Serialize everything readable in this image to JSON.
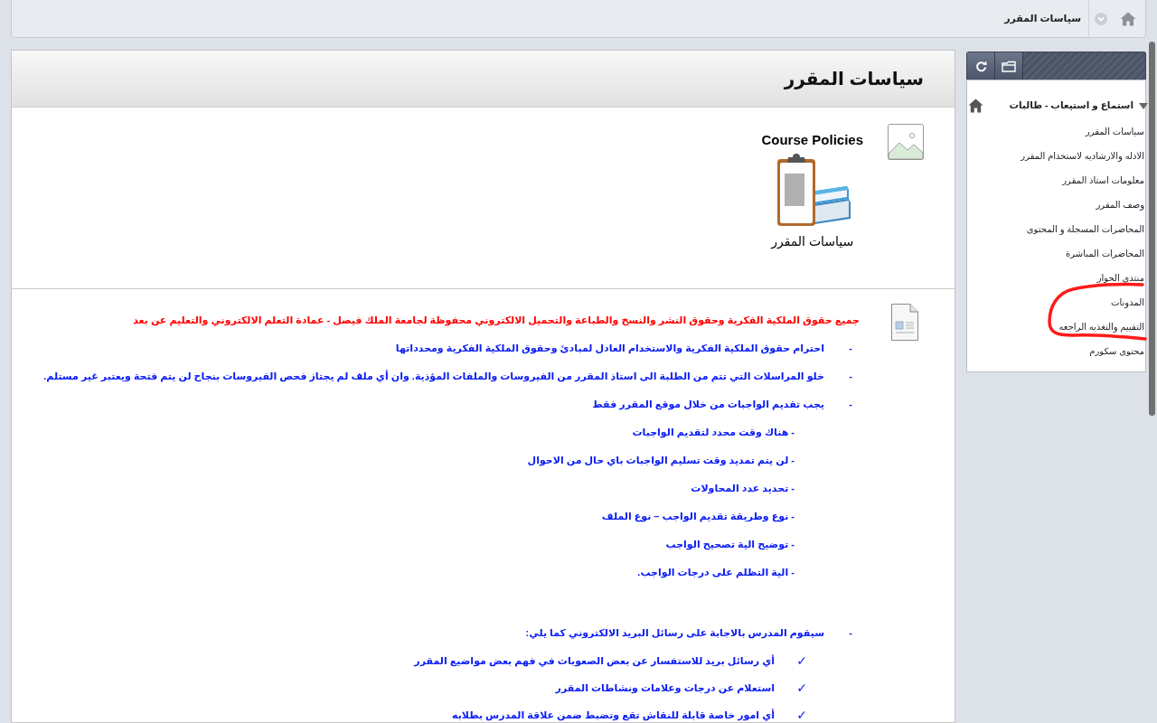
{
  "breadcrumb": [
    "سياسات المقرر"
  ],
  "course_menu": {
    "title": "استماع و استيعاب - طالبات",
    "expanded": true,
    "items": [
      {
        "label": "سياسات المقرر"
      },
      {
        "label": "الادله والارشاديه لاستخدام المقرر"
      },
      {
        "label": "معلومات استاذ المقرر"
      },
      {
        "label": "وصف المقرر"
      },
      {
        "label": "المحاضرات المسجلة و المحتوى"
      },
      {
        "label": "المحاضرات المباشرة"
      },
      {
        "label": "منتدى الحوار"
      },
      {
        "label": "المدونات"
      },
      {
        "label": "التقييم والتغذيه الراجعه"
      },
      {
        "label": "محتوى سكورم"
      }
    ]
  },
  "content": {
    "title": "سياسات المقرر",
    "sections": [
      {
        "kind": "image",
        "heading": "Course Policies",
        "caption": "سياسات المقرر"
      },
      {
        "kind": "document",
        "notice": "جميع حقوق الملكية الفكرية وحقوق النشر والنسخ والطباعة والتحميل الالكتروني محفوظة لجامعة الملك فيصل - عمادة التعلم الالكتروني والتعليم عن بعد",
        "bullets": [
          {
            "marker": "-",
            "text": "احترام حقوق الملكية الفكرية والاستخدام العادل لمبادئ وحقوق الملكية الفكرية ومحدداتها"
          },
          {
            "marker": "-",
            "text": "خلو المراسلات التي تتم من الطلبة الى استاذ المقرر من الفيروسات والملفات المؤذية. وان أي ملف لم يجتاز فحص الفيروسات بنجاح لن يتم فتحة ويعتبر غير مستلم."
          },
          {
            "marker": "-",
            "text": "يجب تقديم الواجبات من خلال موقع المقرر فقط",
            "children": [
              {
                "text": "- هناك وقت محدد لتقديم الواجبات"
              },
              {
                "text": "- لن يتم تمديد وقت تسليم الواجبات باي حال من الاحوال"
              },
              {
                "text": "- تحديد عدد المحاولات"
              },
              {
                "text": "- نوع وطريقة تقديم الواجب – نوع الملف"
              },
              {
                "text": "-  توضيح الية تصحيح الواجب"
              },
              {
                "text": "- الية التظلم على درجات الواجب."
              }
            ]
          },
          {
            "marker": "-",
            "text": "سيقوم المدرس بالاجابة على رسائل البريد الالكتروني كما يلي:",
            "children": [
              {
                "marker": "✓",
                "text": "أي رسائل بريد للاستفسار عن بعض الصعوبات في فهم بعض  مواضيع المقرر"
              },
              {
                "marker": "✓",
                "text": "استعلام عن درجات وعلامات ونشاطات المقرر"
              },
              {
                "marker": "✓",
                "text": "أي امور خاصة قابلة للنقاش تقع وتضبط ضمن علاقة المدرس بطلابه"
              }
            ]
          }
        ]
      }
    ]
  }
}
